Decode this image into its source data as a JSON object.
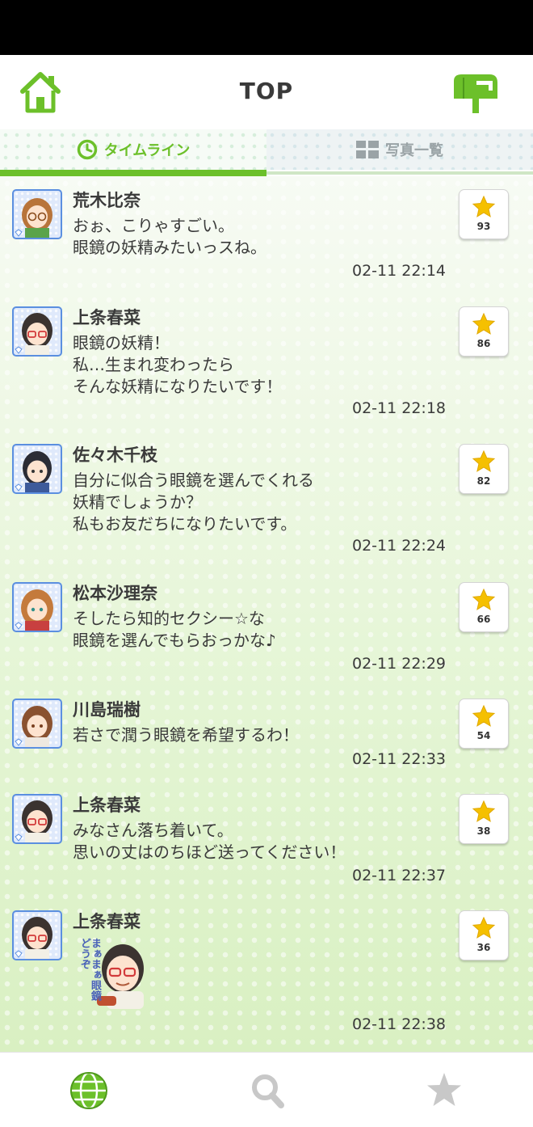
{
  "header": {
    "title": "TOP"
  },
  "tabs": [
    {
      "label": "タイムライン",
      "active": true
    },
    {
      "label": "写真一覧",
      "active": false
    }
  ],
  "posts": [
    {
      "name": "荒木比奈",
      "message": "おぉ、こりゃすごい。\n眼鏡の妖精みたいっスね。",
      "time": "02-11 22:14",
      "stars": "93",
      "hair": "#b8743a"
    },
    {
      "name": "上条春菜",
      "message": "眼鏡の妖精！\n私…生まれ変わったら\nそんな妖精になりたいです！",
      "time": "02-11 22:18",
      "stars": "86",
      "hair": "#3b3330"
    },
    {
      "name": "佐々木千枝",
      "message": "自分に似合う眼鏡を選んでくれる\n妖精でしょうか？\n私もお友だちになりたいです。",
      "time": "02-11 22:24",
      "stars": "82",
      "hair": "#2b2c35"
    },
    {
      "name": "松本沙理奈",
      "message": "そしたら知的セクシー☆な\n眼鏡を選んでもらおっかな♪",
      "time": "02-11 22:29",
      "stars": "66",
      "hair": "#c47a3c"
    },
    {
      "name": "川島瑞樹",
      "message": "若さで潤う眼鏡を希望するわ！",
      "time": "02-11 22:33",
      "stars": "54",
      "hair": "#8a5230"
    },
    {
      "name": "上条春菜",
      "message": "みなさん落ち着いて。\n思いの丈はのちほど送ってください！",
      "time": "02-11 22:37",
      "stars": "38",
      "hair": "#3b3330"
    },
    {
      "name": "上条春菜",
      "message": "",
      "time": "02-11 22:38",
      "stars": "36",
      "hair": "#3b3330",
      "stamp_text": [
        "まぁまぁ",
        "眼鏡どうぞ"
      ]
    }
  ],
  "colors": {
    "accent": "#6cc02a",
    "avatar_border": "#5b8fe0",
    "star": "#f5c000"
  },
  "icons": {
    "home": "home-icon",
    "mailbox": "mailbox-icon",
    "clock": "clock-icon",
    "grid": "grid-icon",
    "globe": "globe-icon",
    "search": "search-icon",
    "star": "star-icon"
  }
}
